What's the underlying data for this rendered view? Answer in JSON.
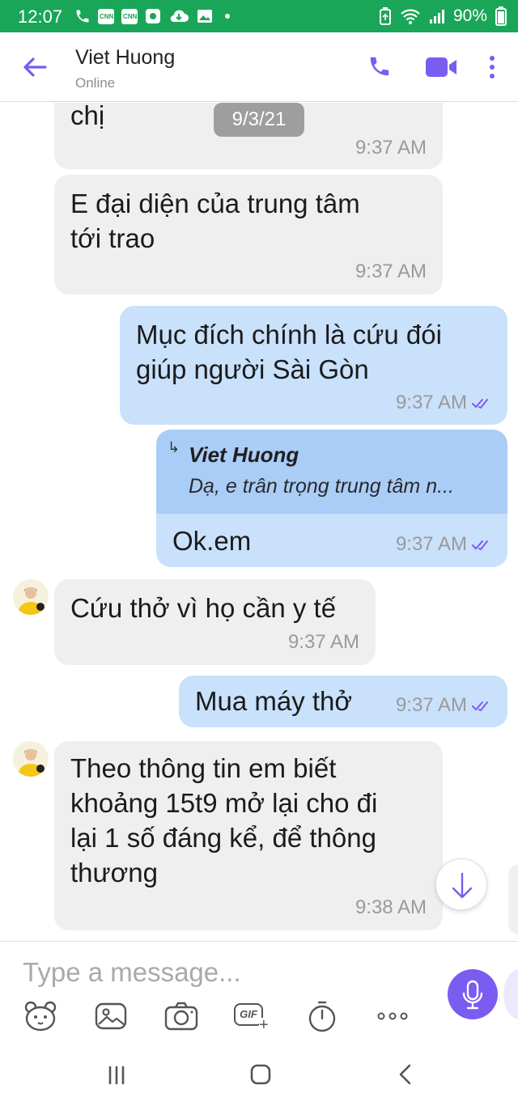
{
  "status_bar": {
    "time": "12:07",
    "battery": "90%",
    "icon_names": [
      "phone-icon",
      "cnn-icon",
      "cnn-icon",
      "app-icon",
      "cloud-icon",
      "image-icon",
      "dot-icon",
      "battery-saver-icon",
      "wifi-icon",
      "signal-icon"
    ],
    "cnn_label": "CNN"
  },
  "header": {
    "name": "Viet Huong",
    "status": "Online"
  },
  "chat": {
    "date_pill": "9/3/21",
    "messages": [
      {
        "dir": "in",
        "text": "chị",
        "time": "9:37 AM"
      },
      {
        "dir": "in",
        "text": "E đại diện của trung tâm\ntới trao",
        "time": "9:37 AM"
      },
      {
        "dir": "out",
        "text": "Mục đích chính là cứu đói\ngiúp người Sài Gòn",
        "time": "9:37 AM"
      },
      {
        "dir": "out",
        "reply_author": "Viet Huong",
        "reply_text": "Dạ, e trân trọng trung tâm n...",
        "text": "Ok.em",
        "time": "9:37 AM"
      },
      {
        "dir": "in",
        "text": "Cứu thở vì họ cần y tế",
        "time": "9:37 AM"
      },
      {
        "dir": "out",
        "text": "Mua máy thở",
        "time": "9:37 AM"
      },
      {
        "dir": "in",
        "text": "Theo thông tin em biết\nkhoảng 15t9 mở lại cho đi\nlại 1 số đáng kể, để thông\nthương",
        "time": "9:38 AM"
      }
    ]
  },
  "composer": {
    "placeholder": "Type a message...",
    "gif_label": "GIF"
  },
  "colors": {
    "status_bar": "#1aa659",
    "accent": "#7a5cf0",
    "incoming_bubble": "#efefef",
    "outgoing_bubble": "#c9e1fb"
  }
}
